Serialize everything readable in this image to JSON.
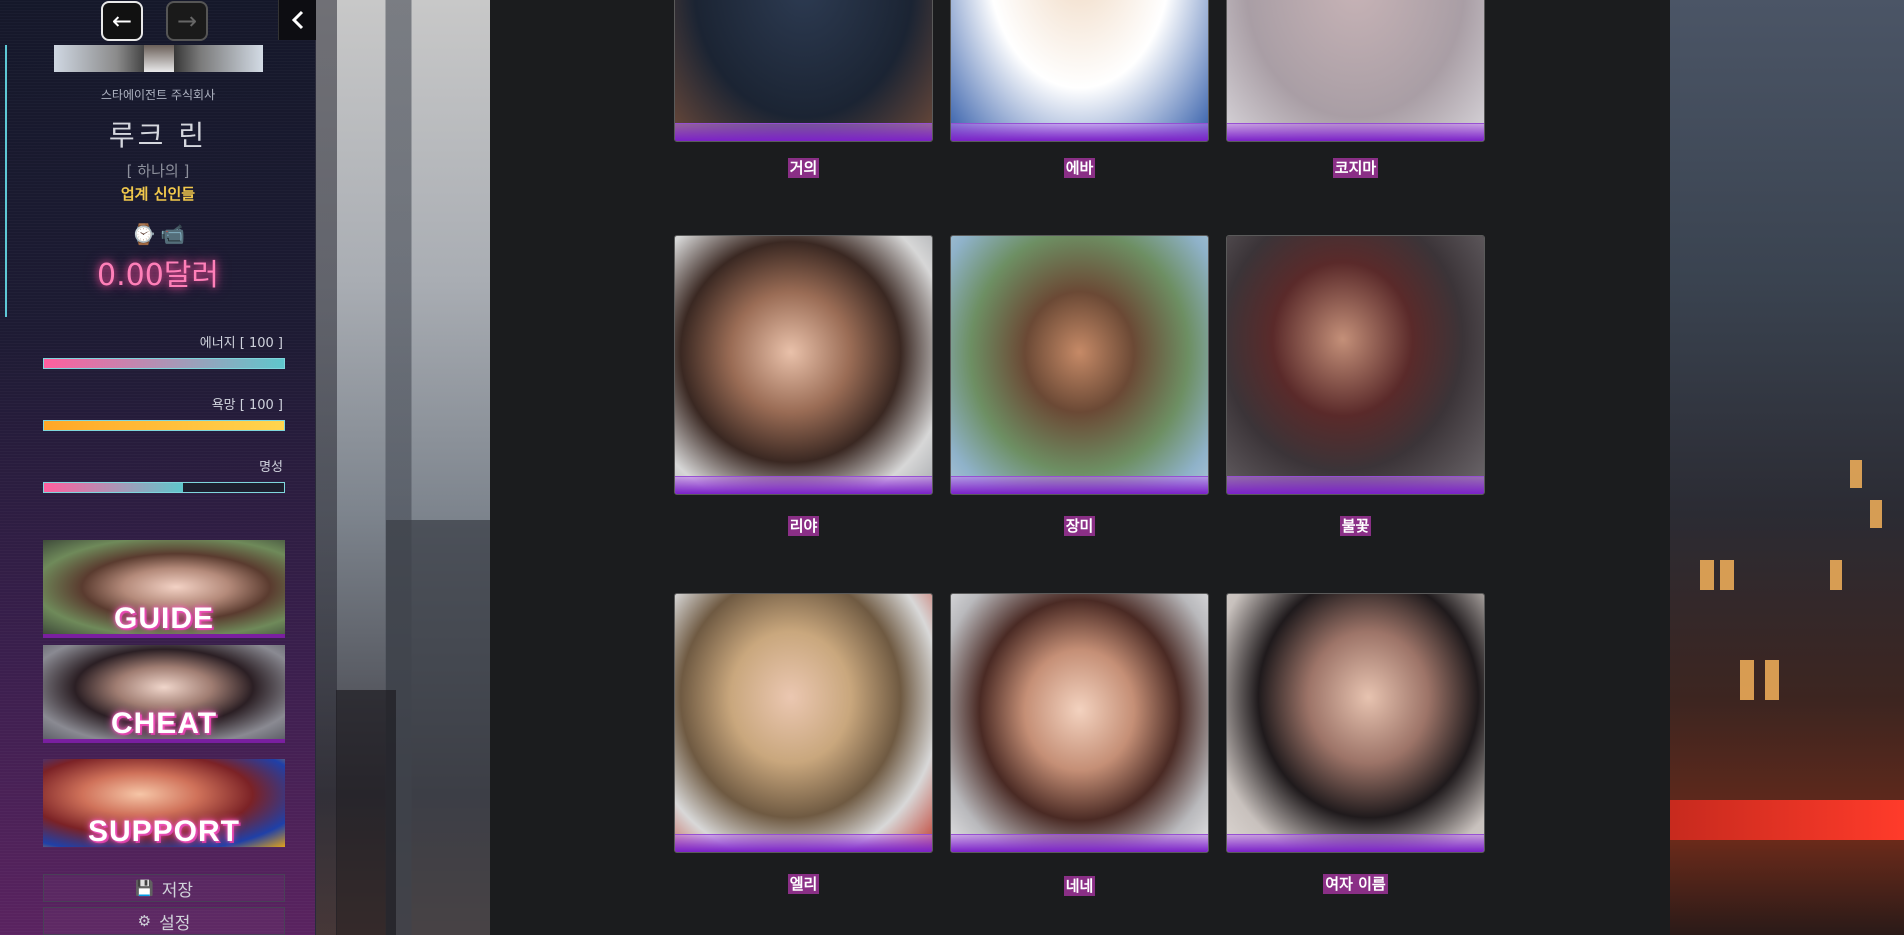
{
  "nav": {
    "back_icon": "arrow-left-icon",
    "forward_icon": "arrow-right-icon",
    "collapse_icon": "chevron-left-icon"
  },
  "profile": {
    "company": "스타에이전트 주식회사",
    "name": "루크 린",
    "status_sub": "[ 하나의 ]",
    "status_main": "업계 신인들",
    "icons": [
      "watch-icon",
      "video-camera-icon"
    ],
    "money": "0.00달러"
  },
  "stats": [
    {
      "label": "에너지 [ 100 ]",
      "value": 1.0
    },
    {
      "label": "욕망 [ 100 ]",
      "value": 1.0
    },
    {
      "label": "명성",
      "value": 0.58
    }
  ],
  "promos": [
    {
      "label": "GUIDE"
    },
    {
      "label": "CHEAT"
    },
    {
      "label": "SUPPORT"
    }
  ],
  "buttons": {
    "save_label": "저장",
    "settings_label": "설정"
  },
  "characters": [
    {
      "name": "거의"
    },
    {
      "name": "에바"
    },
    {
      "name": "코지마"
    },
    {
      "name": "리야"
    },
    {
      "name": "장미"
    },
    {
      "name": "불꽃"
    },
    {
      "name": "엘리"
    },
    {
      "name": "네네"
    },
    {
      "name": "여자 이름"
    }
  ],
  "colors": {
    "accent_pink": "#ff7fb8",
    "status_yellow": "#f2c94c",
    "card_band_purple": "#7b21c8"
  }
}
